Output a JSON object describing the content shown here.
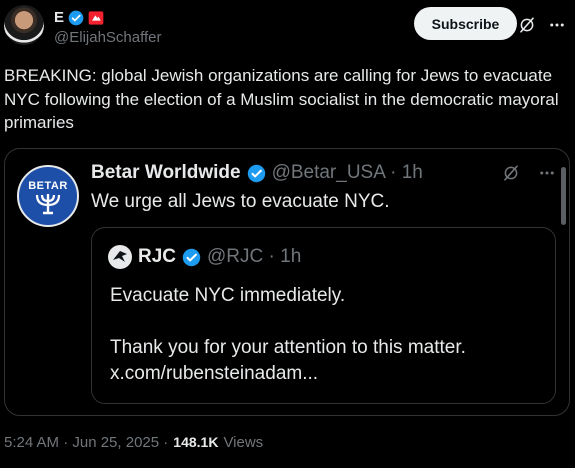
{
  "author": {
    "name": "E",
    "handle": "@ElijahSchaffer",
    "subscribe_label": "Subscribe"
  },
  "tweet": {
    "text": "BREAKING: global Jewish organizations are calling for Jews to evacuate NYC following the election of a Muslim socialist in the democratic mayoral primaries"
  },
  "quoted": {
    "logo_text": "BETAR",
    "name": "Betar Worldwide",
    "handle": "@Betar_USA · 1h",
    "text": "We urge all Jews to evacuate NYC."
  },
  "nested": {
    "name": "RJC",
    "handle": "@RJC · 1h",
    "line1": "Evacuate NYC immediately.",
    "line2": "Thank you for your attention to this matter.",
    "line3": "x.com/rubensteinadam..."
  },
  "footer": {
    "timestamp": "5:24 AM · Jun 25, 2025 ·",
    "views_count": "148.1K",
    "views_label": "Views"
  },
  "icons": {
    "verified": "verified-badge-icon",
    "affiliate": "affiliate-badge-icon",
    "grok": "grok-icon",
    "more": "more-icon"
  },
  "colors": {
    "background": "#000000",
    "text": "#e7e9ea",
    "muted": "#71767b",
    "verified": "#1d9bf0",
    "border": "#2f3336",
    "affiliate": "#f4212e"
  }
}
